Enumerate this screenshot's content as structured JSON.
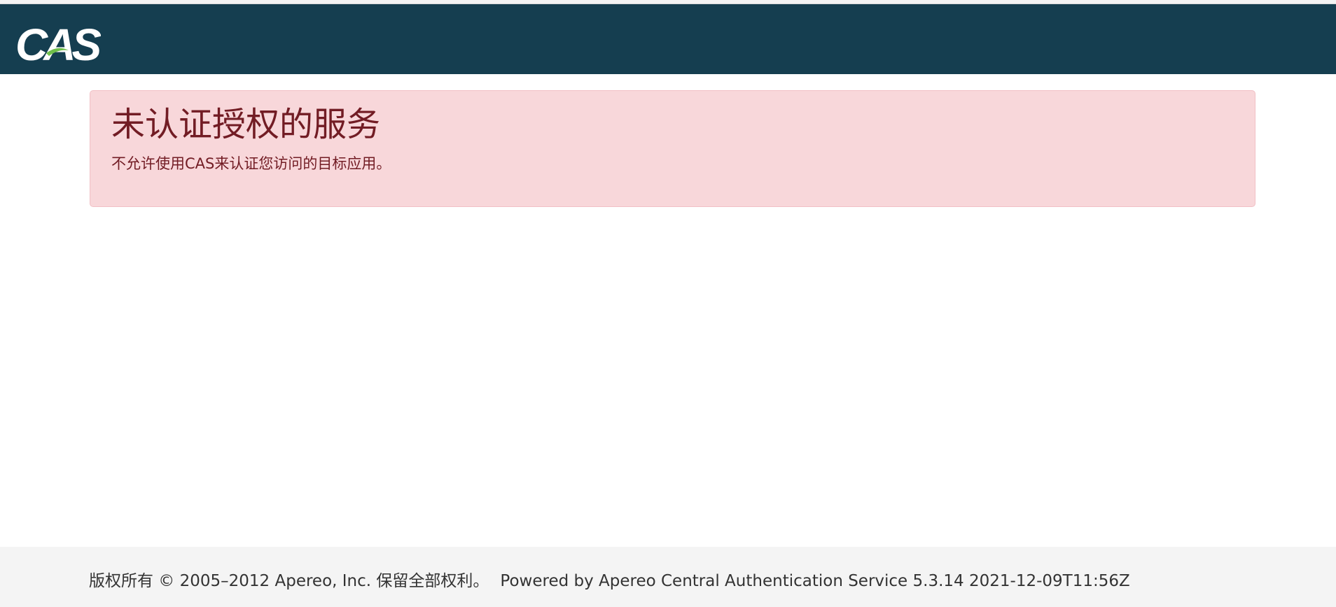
{
  "header": {
    "logo_text": "CAS",
    "brand_color": "#153e50"
  },
  "alert": {
    "title": "未认证授权的服务",
    "message": "不允许使用CAS来认证您访问的目标应用。",
    "background_color": "#f8d7da",
    "text_color": "#721c24"
  },
  "footer": {
    "copyright": "版权所有 © 2005–2012 Apereo, Inc. 保留全部权利。",
    "powered_by_prefix": "Powered by",
    "powered_by_product": "Apereo Central Authentication Service 5.3.14 2021-12-09T11:56Z"
  }
}
